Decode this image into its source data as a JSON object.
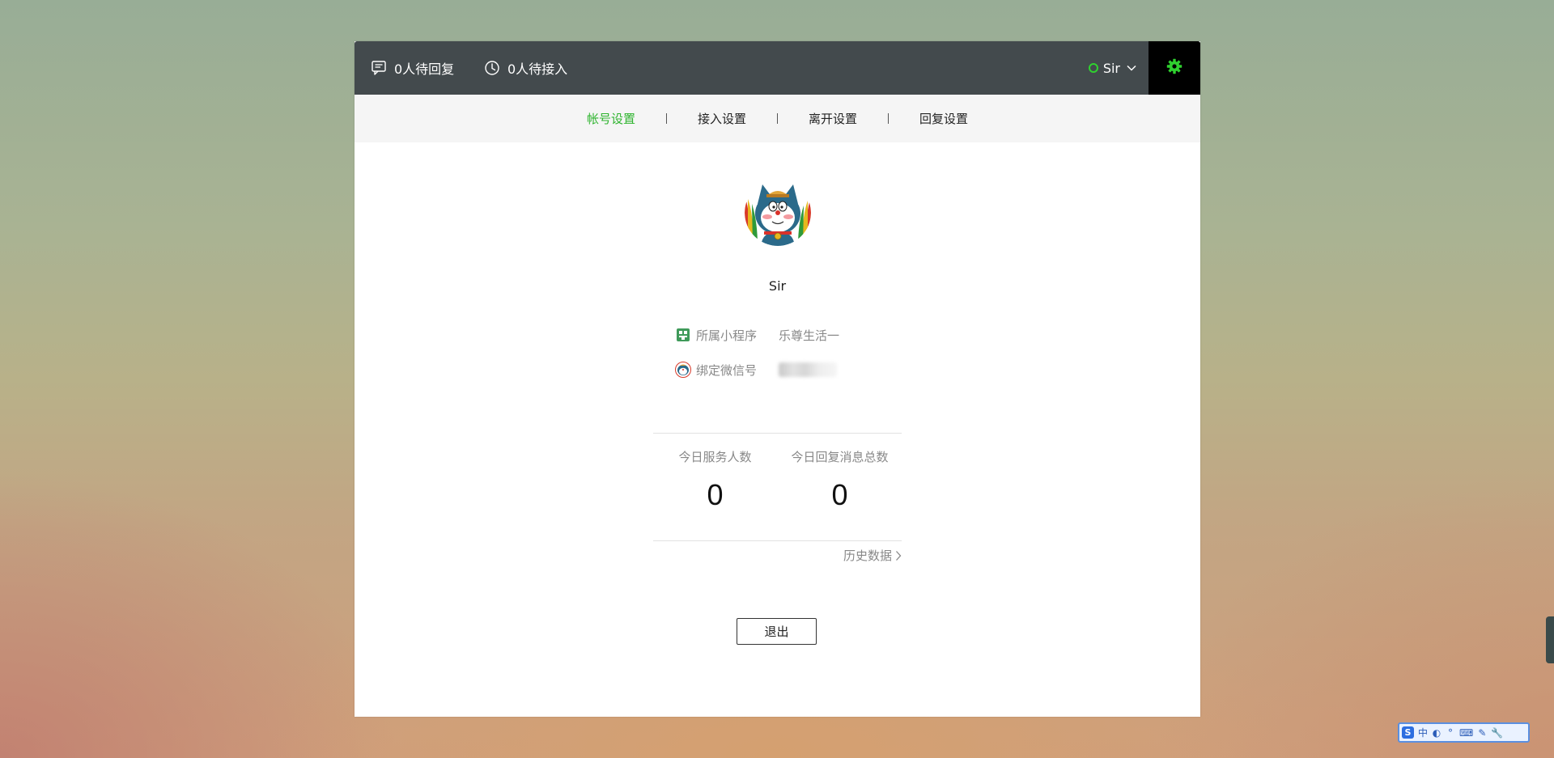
{
  "topbar": {
    "pending_reply": "0人待回复",
    "pending_access": "0人待接入",
    "user_name": "Sir"
  },
  "tabs": [
    {
      "label": "帐号设置",
      "active": true
    },
    {
      "label": "接入设置",
      "active": false
    },
    {
      "label": "离开设置",
      "active": false
    },
    {
      "label": "回复设置",
      "active": false
    }
  ],
  "profile": {
    "name": "Sir",
    "mini_program_label": "所属小程序",
    "mini_program_value": "乐尊生活一",
    "wechat_label": "绑定微信号"
  },
  "stats": {
    "served_label": "今日服务人数",
    "served_value": "0",
    "replies_label": "今日回复消息总数",
    "replies_value": "0"
  },
  "history_link": "历史数据",
  "logout_label": "退出",
  "ime": {
    "items": [
      "中",
      "◐",
      "°",
      "⌨",
      "✎",
      "🔧"
    ]
  },
  "colors": {
    "topbar_bg": "#434a4d",
    "accent_green": "#2fb42f",
    "status_online": "#2fd12f"
  }
}
